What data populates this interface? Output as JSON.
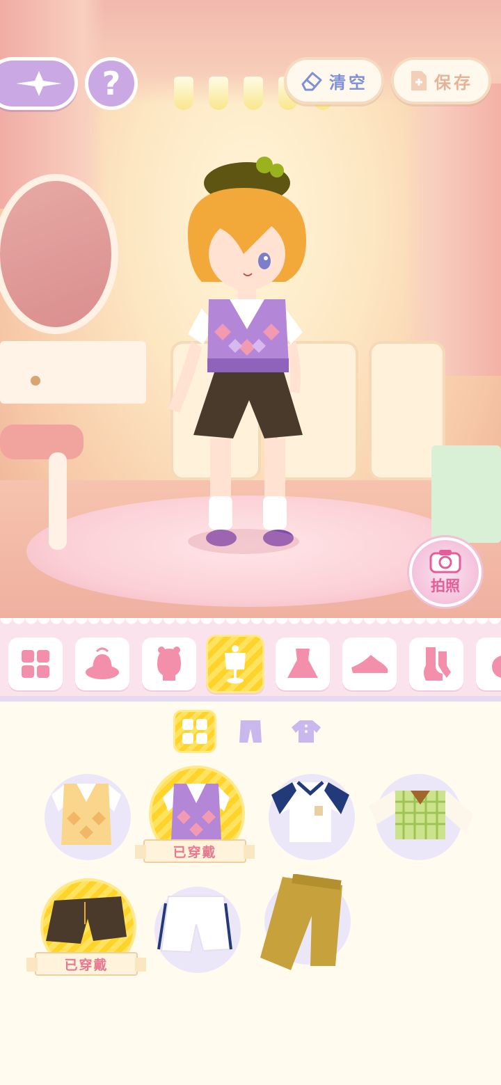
{
  "top_bar": {
    "clear_label": "清空",
    "save_label": "保存",
    "help_label": "?"
  },
  "photo": {
    "label": "拍照"
  },
  "categories": [
    {
      "name": "all-grid-icon"
    },
    {
      "name": "hat-icon"
    },
    {
      "name": "hair-icon"
    },
    {
      "name": "top-mannequin-icon",
      "active": true
    },
    {
      "name": "dress-icon"
    },
    {
      "name": "shoes-icon"
    },
    {
      "name": "socks-icon"
    },
    {
      "name": "accessory-icon"
    }
  ],
  "filters": [
    {
      "name": "all-grid-icon",
      "active": true
    },
    {
      "name": "pants-icon"
    },
    {
      "name": "shirt-icon"
    }
  ],
  "items": {
    "worn_label": "已穿戴",
    "row1": [
      {
        "name": "yellow-argyle-vest",
        "worn": false
      },
      {
        "name": "purple-argyle-vest",
        "worn": true
      },
      {
        "name": "navy-sailor-tee",
        "worn": false
      },
      {
        "name": "green-plaid-vest",
        "worn": false
      }
    ],
    "row2": [
      {
        "name": "brown-shorts",
        "worn": true
      },
      {
        "name": "white-track-shorts",
        "worn": false
      },
      {
        "name": "mustard-pants",
        "worn": false
      }
    ]
  },
  "colors": {
    "accent_yellow": "#ffd42a",
    "lavender": "#c9a8e4",
    "pink_tab_bar": "#fbe3ee",
    "worn_text": "#e7788f"
  }
}
